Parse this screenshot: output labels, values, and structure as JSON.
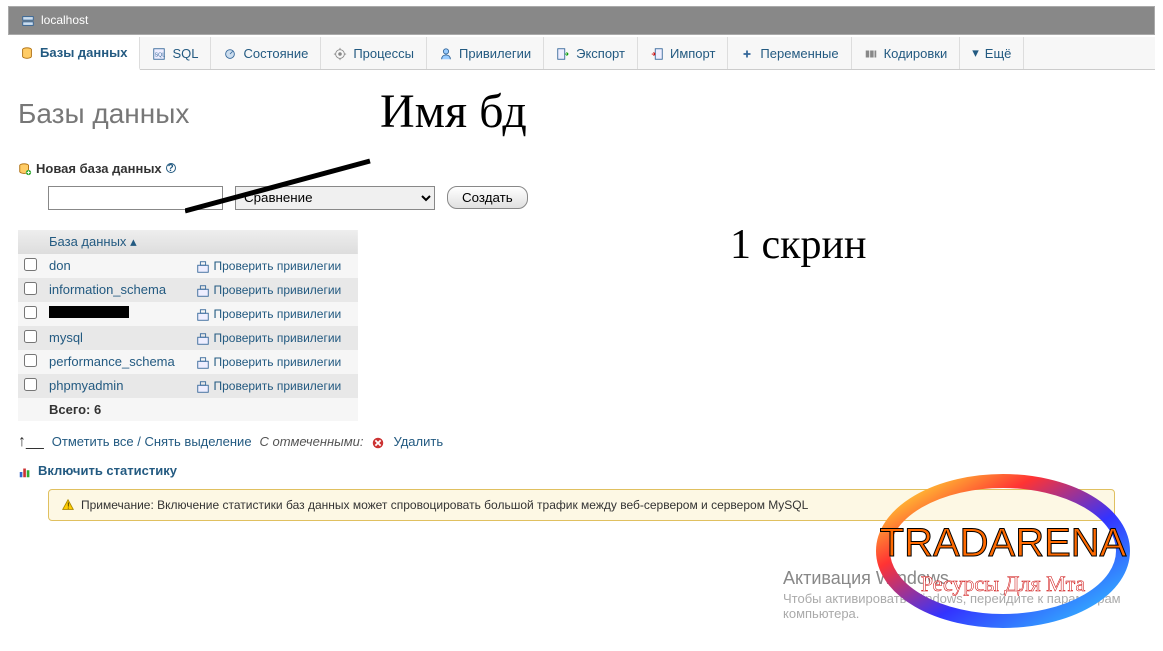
{
  "breadcrumb": {
    "server": "localhost"
  },
  "tabs": [
    {
      "label": "Базы данных",
      "active": true
    },
    {
      "label": "SQL"
    },
    {
      "label": "Состояние"
    },
    {
      "label": "Процессы"
    },
    {
      "label": "Привилегии"
    },
    {
      "label": "Экспорт"
    },
    {
      "label": "Импорт"
    },
    {
      "label": "Переменные"
    },
    {
      "label": "Кодировки"
    },
    {
      "label": "Ещё"
    }
  ],
  "page": {
    "heading": "Базы данных",
    "new_db_label": "Новая база данных",
    "collation_placeholder": "Сравнение",
    "create_button": "Создать"
  },
  "table": {
    "col_db": "База данных",
    "priv_label": "Проверить привилегии",
    "rows": [
      {
        "name": "don",
        "redacted": false
      },
      {
        "name": "information_schema",
        "redacted": false
      },
      {
        "name": "",
        "redacted": true
      },
      {
        "name": "mysql",
        "redacted": false
      },
      {
        "name": "performance_schema",
        "redacted": false
      },
      {
        "name": "phpmyadmin",
        "redacted": false
      }
    ],
    "footer": "Всего: 6"
  },
  "bulk": {
    "check_all": "Отметить все / Снять выделение",
    "with_selected": "С отмеченными:",
    "delete": "Удалить"
  },
  "stats": {
    "enable": "Включить статистику"
  },
  "note": {
    "text": "Примечание: Включение статистики баз данных может спровоцировать большой трафик между веб-сервером и сервером MySQL"
  },
  "activation": {
    "title": "Активация Windows",
    "body": "Чтобы активировать Windows, перейдите к параметрам компьютера."
  },
  "annotations": {
    "title": "Имя бд",
    "skrin": "1 скрин"
  },
  "watermark": {
    "brand": "TRADARENA",
    "subtitle": "Ресурсы Для Мта"
  }
}
